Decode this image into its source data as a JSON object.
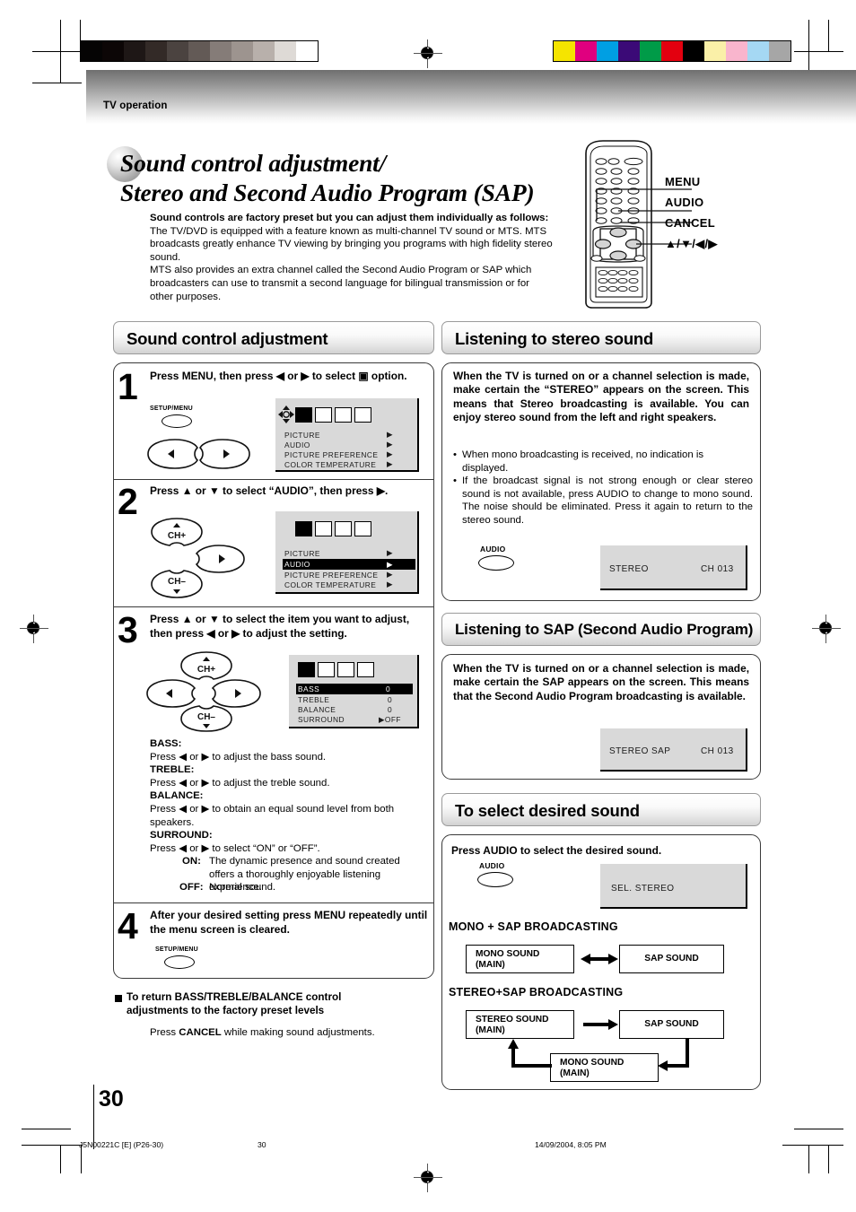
{
  "page": {
    "running_head": "TV operation",
    "title_line1": "Sound control adjustment/",
    "title_line2": "Stereo and Second Audio Program (SAP)",
    "page_number": "30",
    "footer_code": "J5N00221C [E] (P26-30)",
    "footer_page": "30",
    "footer_timestamp": "14/09/2004, 8:05 PM"
  },
  "intro": {
    "lead": "Sound controls are factory preset but you can adjust them individually as follows:",
    "p1": "The TV/DVD is equipped with a feature known as multi-channel TV sound or MTS. MTS broadcasts greatly enhance TV viewing by bringing you programs with high fidelity stereo sound.",
    "p2": "MTS also provides an extra channel called the Second Audio Program or SAP which broadcasters can use to transmit a second language for bilingual transmission or for other purposes."
  },
  "remote": {
    "callouts": [
      "MENU",
      "AUDIO",
      "CANCEL",
      "▲/▼/◀/▶"
    ]
  },
  "left_column": {
    "section_title": "Sound control adjustment",
    "steps": [
      {
        "num": "1",
        "text": "Press MENU, then press ◀ or ▶ to select ▣ option.",
        "key_label": "SETUP/MENU",
        "osd": {
          "rows": [
            {
              "label": "PICTURE",
              "value": "▶",
              "highlight": false
            },
            {
              "label": "AUDIO",
              "value": "▶",
              "highlight": false
            },
            {
              "label": "PICTURE  PREFERENCE",
              "value": "▶",
              "highlight": false
            },
            {
              "label": "COLOR  TEMPERATURE",
              "value": "▶",
              "highlight": false
            }
          ],
          "selected_icon": 0
        }
      },
      {
        "num": "2",
        "text": "Press ▲ or ▼ to select “AUDIO”, then press ▶.",
        "key_up": "CH+",
        "key_down": "CH–",
        "osd": {
          "rows": [
            {
              "label": "PICTURE",
              "value": "▶",
              "highlight": false
            },
            {
              "label": "AUDIO",
              "value": "▶",
              "highlight": true
            },
            {
              "label": "PICTURE  PREFERENCE",
              "value": "▶",
              "highlight": false
            },
            {
              "label": "COLOR  TEMPERATURE",
              "value": "▶",
              "highlight": false
            }
          ],
          "selected_icon": 0
        }
      },
      {
        "num": "3",
        "text": "Press ▲ or ▼ to select the item you want to adjust, then press ◀ or ▶ to adjust the setting.",
        "key_up": "CH+",
        "key_down": "CH–",
        "osd": {
          "rows": [
            {
              "label": "BASS",
              "value": "0",
              "highlight": true
            },
            {
              "label": "TREBLE",
              "value": "0",
              "highlight": false
            },
            {
              "label": "BALANCE",
              "value": "0",
              "highlight": false
            },
            {
              "label": "SURROUND",
              "value": "▶OFF",
              "highlight": false
            }
          ],
          "selected_icon": 0
        }
      },
      {
        "num": "4",
        "text": "After your desired setting press MENU repeatedly until the menu screen is cleared.",
        "key_label": "SETUP/MENU"
      }
    ],
    "adjust_items": [
      {
        "name": "BASS:",
        "desc": "Press ◀ or ▶ to adjust the bass sound."
      },
      {
        "name": "TREBLE:",
        "desc": "Press ◀ or ▶ to adjust the treble sound."
      },
      {
        "name": "BALANCE:",
        "desc": "Press ◀ or ▶ to obtain an equal sound level from both speakers."
      },
      {
        "name": "SURROUND:",
        "desc": "Press ◀ or ▶ to select “ON” or “OFF”."
      }
    ],
    "surround_on_label": "ON:",
    "surround_on_desc": "The dynamic presence and sound created offers a thoroughly enjoyable listening experience.",
    "surround_off_label": "OFF:",
    "surround_off_desc": "Normal sound.",
    "note_heading": "To return BASS/TREBLE/BALANCE control adjustments to the factory preset levels",
    "note_body_pre": "Press ",
    "note_body_bold": "CANCEL",
    "note_body_post": " while making sound adjustments."
  },
  "right_column": {
    "stereo": {
      "section_title": "Listening to stereo sound",
      "lead": "When the TV is turned on or a channel selection is made, make certain the “STEREO” appears on the screen. This means that Stereo broadcasting is available. You can enjoy stereo sound from the left and right speakers.",
      "bullets": [
        "When mono broadcasting is received, no indication is displayed.",
        "If the broadcast signal is not strong enough or clear stereo sound is not available, press AUDIO to change to mono sound. The noise should be eliminated. Press it again to return to the stereo sound."
      ],
      "key_label": "AUDIO",
      "osd_left": "STEREO",
      "osd_right": "CH 013"
    },
    "sap": {
      "section_title": "Listening to SAP (Second Audio Program)",
      "lead": "When the TV is turned on or a channel selection is made, make certain the SAP appears on the screen. This means that the Second Audio Program broadcasting is available.",
      "osd_left": "STEREO  SAP",
      "osd_right": "CH 013"
    },
    "select_sound": {
      "section_title": "To select desired sound",
      "lead": "Press AUDIO to select the desired sound.",
      "key_label": "AUDIO",
      "osd_text": "SEL. STEREO",
      "mode1_title": "MONO + SAP BROADCASTING",
      "mode1_boxes": [
        {
          "line1": "MONO SOUND",
          "line2": "(MAIN)"
        },
        {
          "line1": "SAP SOUND",
          "line2": ""
        }
      ],
      "mode2_title": "STEREO+SAP BROADCASTING",
      "mode2_boxes": [
        {
          "line1": "STEREO SOUND",
          "line2": "(MAIN)"
        },
        {
          "line1": "SAP SOUND",
          "line2": ""
        },
        {
          "line1": "MONO SOUND",
          "line2": "(MAIN)"
        }
      ]
    }
  },
  "calibration": {
    "gray_swatches": [
      "#050404",
      "#0c0606",
      "#1e1716",
      "#332a27",
      "#4b4340",
      "#635a56",
      "#857c78",
      "#9d948f",
      "#b8b0ab",
      "#dedad6",
      "#ffffff"
    ],
    "color_swatches": [
      "#f5e400",
      "#e0007f",
      "#009fe3",
      "#3b0a77",
      "#009b48",
      "#e3000f",
      "#000000",
      "#faf0a8",
      "#f9b5cd",
      "#a5d8f3",
      "#a6a6a6"
    ]
  }
}
